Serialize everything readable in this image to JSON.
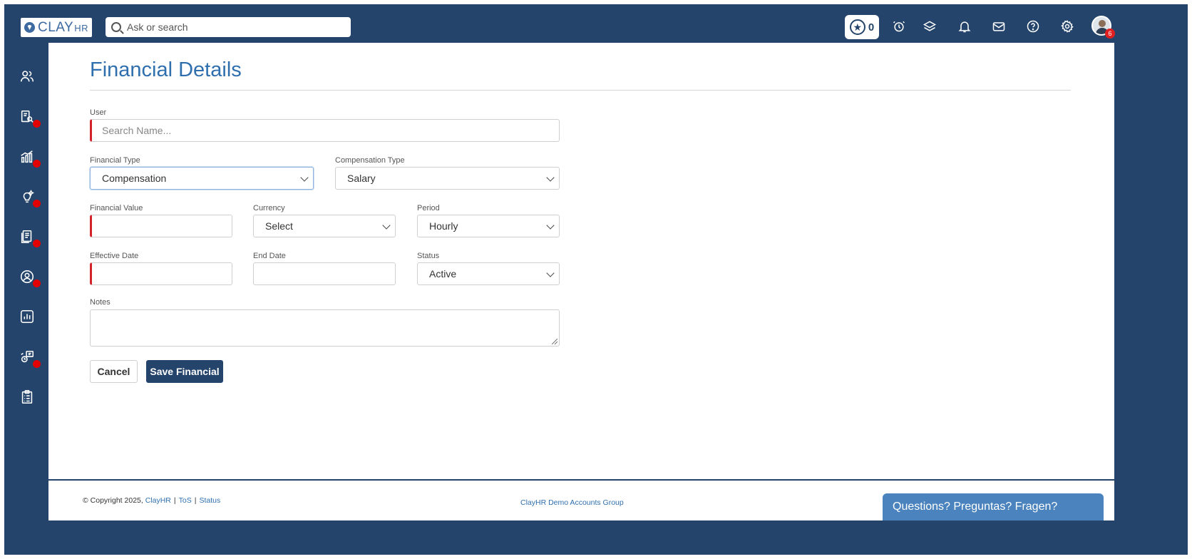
{
  "app": {
    "logo_text": "CLAY",
    "logo_suffix": "HR",
    "search_placeholder": "Ask or search",
    "points": "0",
    "notification_count": "6"
  },
  "topbar_icons": [
    "alarm-clock-icon",
    "layers-icon",
    "bell-icon",
    "mail-icon",
    "help-circle-icon",
    "gear-icon"
  ],
  "sidebar_icons": [
    "users-icon",
    "payroll-search-icon",
    "growth-chart-icon",
    "lightbulb-icon",
    "documents-icon",
    "user-circle-icon",
    "report-chart-icon",
    "workflow-icon",
    "clipboard-icon"
  ],
  "page": {
    "title": "Financial Details"
  },
  "form": {
    "user_label": "User",
    "user_placeholder": "Search Name...",
    "financial_type_label": "Financial Type",
    "financial_type_value": "Compensation",
    "compensation_type_label": "Compensation Type",
    "compensation_type_value": "Salary",
    "financial_value_label": "Financial Value",
    "financial_value": "",
    "currency_label": "Currency",
    "currency_value": "Select",
    "period_label": "Period",
    "period_value": "Hourly",
    "effective_date_label": "Effective Date",
    "effective_date_value": "",
    "end_date_label": "End Date",
    "end_date_value": "",
    "status_label": "Status",
    "status_value": "Active",
    "notes_label": "Notes",
    "cancel_label": "Cancel",
    "save_label": "Save Financial"
  },
  "footer": {
    "copyright": "© Copyright 2025,",
    "company_link": "ClayHR",
    "tos_link": "ToS",
    "status_link": "Status",
    "group": "ClayHR Demo Accounts Group"
  },
  "help_widget": {
    "label": "Questions? Preguntas? Fragen?"
  },
  "colors": {
    "brand_navy": "#24446b",
    "title_blue": "#2f6fae",
    "required_red": "#d4222a",
    "help_blue": "#4a83bd"
  }
}
